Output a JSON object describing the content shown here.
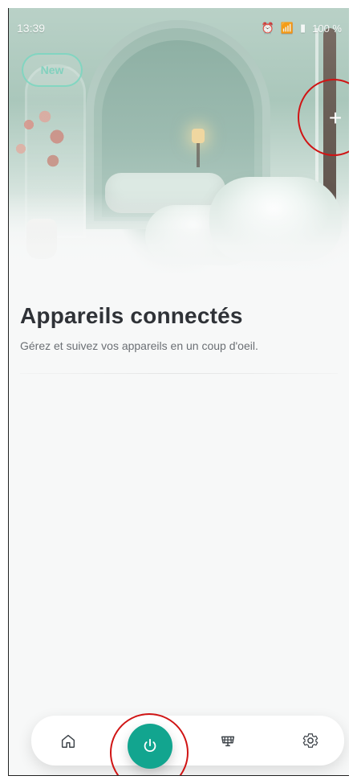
{
  "status_bar": {
    "time": "13:39",
    "battery": "100 %"
  },
  "top": {
    "new_label": "New",
    "add_label": "+"
  },
  "content": {
    "title": "Appareils connectés",
    "subtitle": "Gérez et suivez vos appareils en un coup d'oeil."
  },
  "bottom_nav": {
    "items": [
      {
        "name": "home",
        "icon": "home-icon"
      },
      {
        "name": "devices",
        "icon": "power-icon"
      },
      {
        "name": "solar",
        "icon": "solar-panel-icon"
      },
      {
        "name": "settings",
        "icon": "gear-icon"
      }
    ]
  },
  "colors": {
    "accent": "#12a58f",
    "highlight": "#d01414"
  }
}
